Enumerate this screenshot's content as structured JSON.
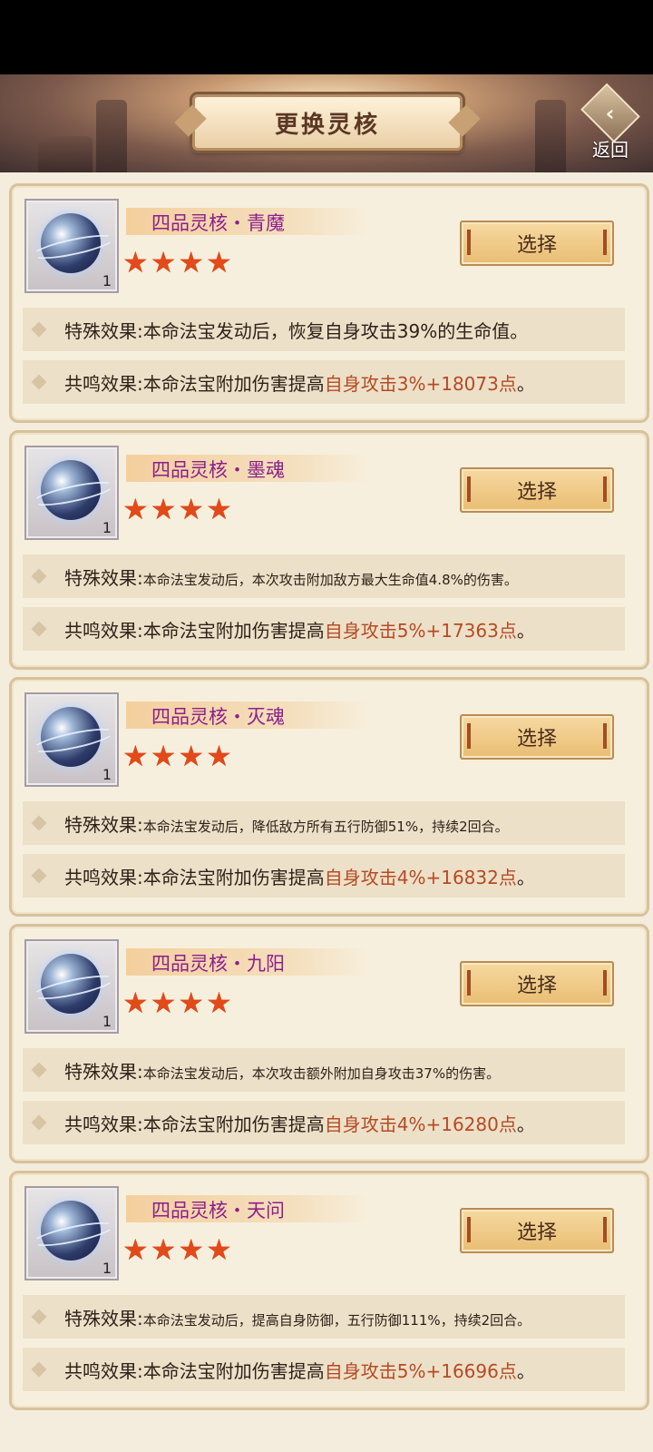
{
  "header": {
    "title": "更换灵核",
    "back_label": "返回"
  },
  "cards": [
    {
      "name": "四品灵核・青魔",
      "count": "1",
      "stars": 4,
      "select_label": "选择",
      "special_label": "特殊效果:",
      "special_text": "本命法宝发动后，恢复自身攻击39%的生命值。",
      "resonance_label": "共鸣效果:",
      "resonance_prefix": "本命法宝附加伤害提高",
      "resonance_highlight": "自身攻击3%+18073点",
      "resonance_suffix": "。"
    },
    {
      "name": "四品灵核・墨魂",
      "count": "1",
      "stars": 4,
      "select_label": "选择",
      "special_label": "特殊效果:",
      "special_text": "本命法宝发动后，本次攻击附加敌方最大生命值4.8%的伤害。",
      "resonance_label": "共鸣效果:",
      "resonance_prefix": "本命法宝附加伤害提高",
      "resonance_highlight": "自身攻击5%+17363点",
      "resonance_suffix": "。"
    },
    {
      "name": "四品灵核・灭魂",
      "count": "1",
      "stars": 4,
      "select_label": "选择",
      "special_label": "特殊效果:",
      "special_text": "本命法宝发动后，降低敌方所有五行防御51%，持续2回合。",
      "resonance_label": "共鸣效果:",
      "resonance_prefix": "本命法宝附加伤害提高",
      "resonance_highlight": "自身攻击4%+16832点",
      "resonance_suffix": "。"
    },
    {
      "name": "四品灵核・九阳",
      "count": "1",
      "stars": 4,
      "select_label": "选择",
      "special_label": "特殊效果:",
      "special_text": "本命法宝发动后，本次攻击额外附加自身攻击37%的伤害。",
      "resonance_label": "共鸣效果:",
      "resonance_prefix": "本命法宝附加伤害提高",
      "resonance_highlight": "自身攻击4%+16280点",
      "resonance_suffix": "。"
    },
    {
      "name": "四品灵核・天问",
      "count": "1",
      "stars": 4,
      "select_label": "选择",
      "special_label": "特殊效果:",
      "special_text": "本命法宝发动后，提高自身防御，五行防御111%，持续2回合。",
      "resonance_label": "共鸣效果:",
      "resonance_prefix": "本命法宝附加伤害提高",
      "resonance_highlight": "自身攻击5%+16696点",
      "resonance_suffix": "。"
    }
  ]
}
